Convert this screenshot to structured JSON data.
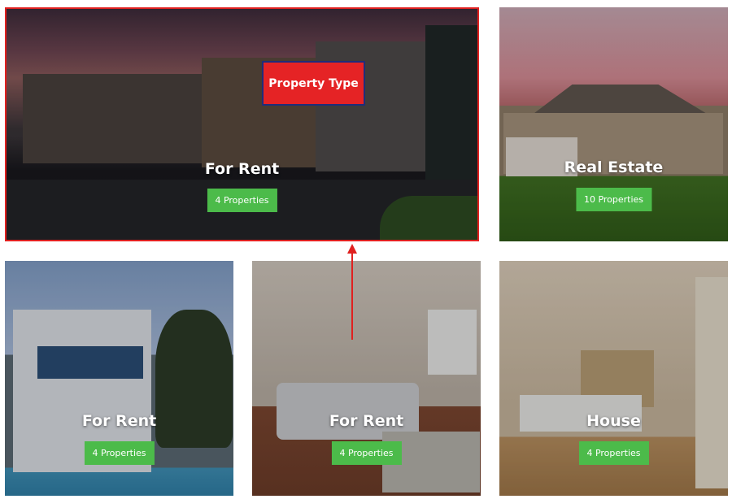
{
  "annotation": {
    "label": "Property Type",
    "color": "#e52325",
    "border_color": "#1f2d7a"
  },
  "tiles": [
    {
      "title": "For Rent",
      "count": "4 Properties",
      "image": "apartments-dusk"
    },
    {
      "title": "Real Estate",
      "count": "10 Properties",
      "image": "suburban-house"
    },
    {
      "title": "For Rent",
      "count": "4 Properties",
      "image": "beach-house"
    },
    {
      "title": "For Rent",
      "count": "4 Properties",
      "image": "living-room"
    },
    {
      "title": "House",
      "count": "4 Properties",
      "image": "bedroom"
    }
  ],
  "colors": {
    "badge": "#4cbb4a",
    "highlight_border": "#e0201f"
  }
}
